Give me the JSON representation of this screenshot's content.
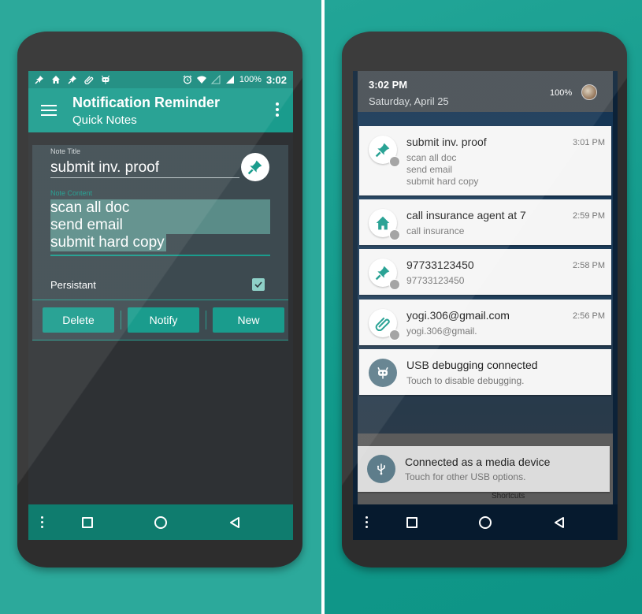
{
  "left": {
    "status_bar": {
      "notification_icons": [
        "pin-icon",
        "home-icon",
        "pin-icon",
        "paperclip-icon",
        "android-debug-icon"
      ],
      "system_icons": [
        "alarm-icon",
        "wifi-icon",
        "signal-empty-icon",
        "signal-full-icon"
      ],
      "battery": "100%",
      "time": "3:02"
    },
    "app_bar": {
      "title": "Notification Reminder",
      "subtitle": "Quick Notes",
      "menu_icon": "hamburger-icon",
      "overflow_icon": "more-vert-icon"
    },
    "note": {
      "title_label": "Note Title",
      "title_value": "submit inv. proof",
      "pin_icon": "pin-icon",
      "content_label": "Note Content",
      "content_lines": [
        "scan all doc",
        "send email",
        "submit hard copy"
      ],
      "persistent_label": "Persistant",
      "persistent_checked": true
    },
    "buttons": {
      "delete": "Delete",
      "notify": "Notify",
      "new": "New"
    },
    "nav": [
      "more-vert-icon",
      "recents-icon",
      "home-circle-icon",
      "back-icon"
    ],
    "colors": {
      "primary": "#1a9c8d",
      "status_bar": "#16897c",
      "nav_bar": "#0f7c6e",
      "card": "#3d4a50"
    }
  },
  "right": {
    "header": {
      "time": "3:02 PM",
      "date": "Saturday, April 25",
      "battery": "100%"
    },
    "notifications": [
      {
        "icon": "pin-icon",
        "title": "submit inv. proof",
        "time": "3:01 PM",
        "lines": [
          "scan all doc",
          "send email",
          "submit hard copy"
        ]
      },
      {
        "icon": "home-icon",
        "title": "call insurance agent at 7",
        "time": "2:59 PM",
        "lines": [
          "call insurance"
        ]
      },
      {
        "icon": "pin-icon",
        "title": "97733123450",
        "time": "2:58 PM",
        "lines": [
          "97733123450"
        ]
      },
      {
        "icon": "paperclip-icon",
        "title": "yogi.306@gmail.com",
        "time": "2:56 PM",
        "lines": [
          "yogi.306@gmail."
        ]
      },
      {
        "icon": "android-debug-icon",
        "title": "USB debugging connected",
        "time": "",
        "lines": [
          "Touch to disable debugging."
        ]
      },
      {
        "icon": "usb-icon",
        "title": "Connected as a media device",
        "time": "",
        "lines": [
          "Touch for other USB options."
        ]
      }
    ],
    "shortcuts_label": "Shortcuts",
    "nav": [
      "more-vert-icon",
      "recents-icon",
      "home-circle-icon",
      "back-icon"
    ]
  }
}
